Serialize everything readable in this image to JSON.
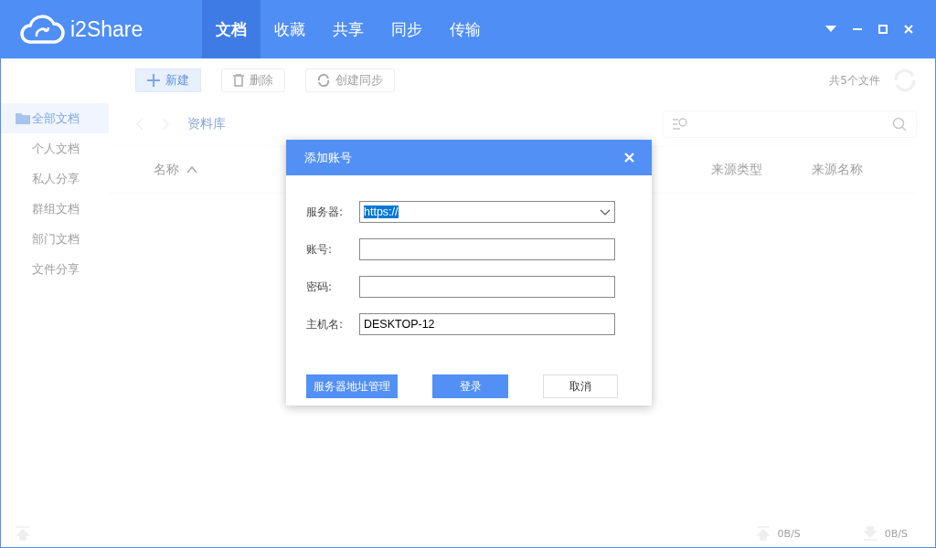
{
  "app": {
    "name": "i2Share"
  },
  "tabs": [
    {
      "label": "文档",
      "selected": true
    },
    {
      "label": "收藏",
      "selected": false
    },
    {
      "label": "共享",
      "selected": false
    },
    {
      "label": "同步",
      "selected": false
    },
    {
      "label": "传输",
      "selected": false
    }
  ],
  "toolbar": {
    "buttons": [
      {
        "label": "新建",
        "kind": "new"
      },
      {
        "label": "删除",
        "kind": "delete"
      },
      {
        "label": "创建同步",
        "kind": "sync"
      }
    ],
    "file_count": "共5个文件"
  },
  "sidebar": {
    "items": [
      {
        "label": "全部文档",
        "selected": true
      },
      {
        "label": "个人文档",
        "selected": false
      },
      {
        "label": "私人分享",
        "selected": false
      },
      {
        "label": "群组文档",
        "selected": false
      },
      {
        "label": "部门文档",
        "selected": false
      },
      {
        "label": "文件分享",
        "selected": false
      }
    ]
  },
  "breadcrumb": "资料库",
  "table": {
    "columns": [
      {
        "label": "名称",
        "sorted": true
      },
      {
        "label": "来源类型",
        "sorted": false
      },
      {
        "label": "来源名称",
        "sorted": false
      }
    ]
  },
  "status_bar": {
    "upload_rate": "0B/S",
    "download_rate": "0B/S"
  },
  "dialog": {
    "title": "添加账号",
    "fields": [
      {
        "label": "服务器:",
        "kind": "dropdown",
        "value": "https://",
        "highlighted": true
      },
      {
        "label": "账号:",
        "kind": "text"
      },
      {
        "label": "密码:",
        "kind": "text"
      },
      {
        "label": "主机名:",
        "kind": "text",
        "value": "DESKTOP-12",
        "highlighted": false
      }
    ],
    "buttons": [
      {
        "label": "服务器地址管理",
        "kind": "primary"
      },
      {
        "label": "登录",
        "kind": "primary"
      },
      {
        "label": "取消",
        "kind": "secondary"
      }
    ]
  }
}
